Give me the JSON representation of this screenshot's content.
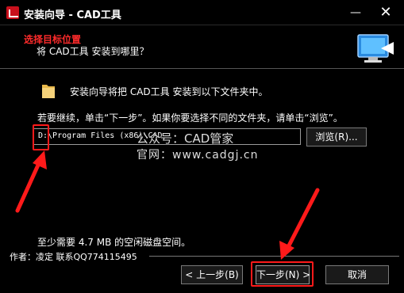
{
  "window": {
    "title": "安装向导 - CAD工具",
    "min_glyph": "—",
    "close_glyph": "✕",
    "app_icon": "cad-app-icon"
  },
  "header": {
    "step_title": "选择目标位置",
    "step_subtitle": "将 CAD工具 安装到哪里？",
    "graphic_icon": "computer-install-icon"
  },
  "body": {
    "folder_icon": "folder-icon",
    "intro": "安装向导将把 CAD工具 安装到以下文件夹中。",
    "instruction": "若要继续，单击“下一步”。如果你要选择不同的文件夹，请单击“浏览”。",
    "path_value": "D:\\Program Files (x86)\\CAD",
    "browse_label": "浏览(R)...",
    "space_required": "至少需要 4.7 MB 的空闲磁盘空间。"
  },
  "watermark": {
    "line1": "公众号：CAD管家",
    "line2": "官网：www.cadgj.cn"
  },
  "footer": {
    "author_line": "作者：凌定   联系QQ774115495",
    "back_label": "< 上一步(B)",
    "next_label": "下一步(N) >",
    "cancel_label": "取消"
  },
  "colors": {
    "background": "#000000",
    "accent_red": "#ff1a1a",
    "text": "#ffffff"
  }
}
